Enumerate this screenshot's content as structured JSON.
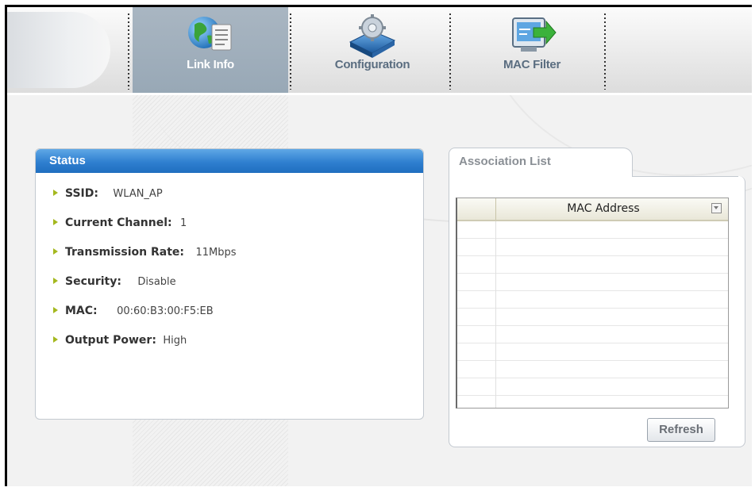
{
  "nav": {
    "items": [
      {
        "label": "Link Info",
        "icon": "globe-document-icon",
        "active": true
      },
      {
        "label": "Configuration",
        "icon": "gear-device-icon",
        "active": false
      },
      {
        "label": "MAC Filter",
        "icon": "monitor-arrow-icon",
        "active": false
      }
    ]
  },
  "status": {
    "title": "Status",
    "rows": [
      {
        "key": "SSID:",
        "value": "WLAN_AP"
      },
      {
        "key": "Current Channel:",
        "value": "1"
      },
      {
        "key": "Transmission Rate:",
        "value": "11Mbps"
      },
      {
        "key": "Security:",
        "value": "Disable"
      },
      {
        "key": "MAC:",
        "value": "00:60:B3:00:F5:EB"
      },
      {
        "key": "Output Power:",
        "value": "High"
      }
    ]
  },
  "association": {
    "tab_label": "Association List",
    "columns": [
      "",
      "MAC Address"
    ],
    "rows": [],
    "refresh_label": "Refresh"
  },
  "colors": {
    "status_header": "#2f7fd0",
    "nav_active": "#9fb0be",
    "bullet": "#a4b81e"
  }
}
